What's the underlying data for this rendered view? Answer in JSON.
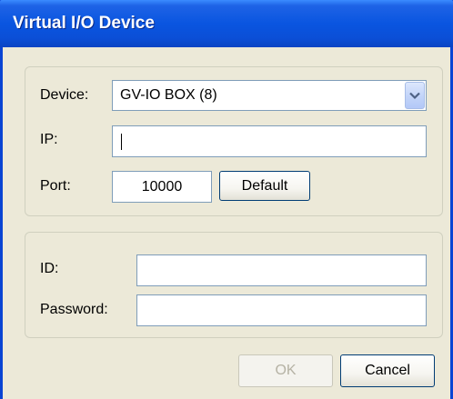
{
  "window": {
    "title": "Virtual I/O Device"
  },
  "connection": {
    "device_label": "Device:",
    "device_value": "GV-IO BOX (8)",
    "ip_label": "IP:",
    "ip_value": "",
    "port_label": "Port:",
    "port_value": "10000",
    "default_button": "Default"
  },
  "credentials": {
    "id_label": "ID:",
    "id_value": "",
    "password_label": "Password:",
    "password_value": ""
  },
  "buttons": {
    "ok": "OK",
    "cancel": "Cancel"
  },
  "colors": {
    "titlebar": "#0a55e0",
    "frame": "#0a44d3",
    "dialog_bg": "#ece9d8"
  }
}
